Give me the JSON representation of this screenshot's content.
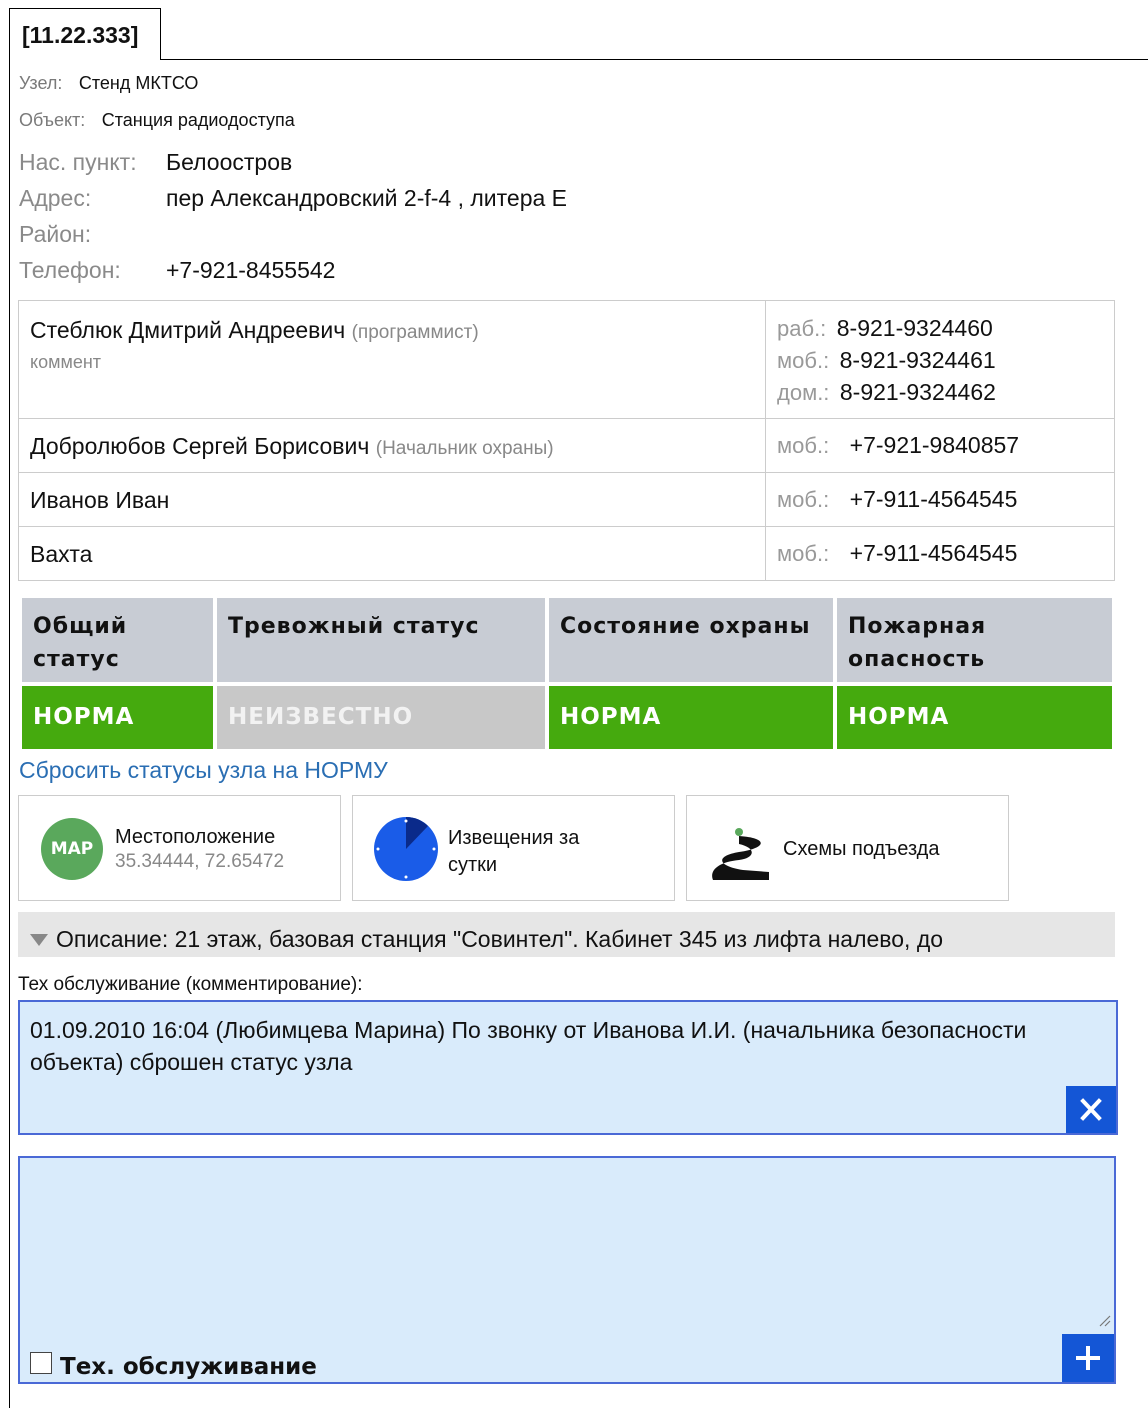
{
  "tab": {
    "label": "[11.22.333]"
  },
  "node": {
    "uzel_label": "Узел:",
    "uzel_value": "Стенд МКТСО",
    "object_label": "Объект:",
    "object_value": "Станция радиодоступа",
    "city_label": "Нас. пункт:",
    "city_value": "Белоостров",
    "address_label": "Адрес:",
    "address_value": "пер Александровский 2-f-4 , литера Е",
    "district_label": "Район:",
    "district_value": "",
    "phone_label": "Телефон:",
    "phone_value": "+7-921-8455542"
  },
  "contacts": [
    {
      "name": "Стеблюк Дмитрий Андреевич",
      "role": "(программист)",
      "comment": "коммент",
      "phones": [
        {
          "type": "раб.:",
          "number": "8-921-9324460"
        },
        {
          "type": "моб.:",
          "number": "8-921-9324461"
        },
        {
          "type": "дом.:",
          "number": "8-921-9324462"
        }
      ]
    },
    {
      "name": "Добролюбов Сергей Борисович",
      "role": "(Начальник охраны)",
      "phones": [
        {
          "type": "моб.:",
          "number": "+7-921-9840857"
        }
      ]
    },
    {
      "name": "Иванов Иван",
      "phones": [
        {
          "type": "моб.:",
          "number": "+7-911-4564545"
        }
      ]
    },
    {
      "name": "Вахта",
      "phones": [
        {
          "type": "моб.:",
          "number": "+7-911-4564545"
        }
      ]
    }
  ],
  "statuses": [
    {
      "header": "Общий статус",
      "value": "НОРМА",
      "color": "#45aa0e"
    },
    {
      "header": "Тревожный статус",
      "value": "НЕИЗВЕСТНО",
      "color": "#c8c8c8"
    },
    {
      "header": "Состояние охраны",
      "value": "НОРМА",
      "color": "#45aa0e"
    },
    {
      "header": "Пожарная опасность",
      "value": "НОРМА",
      "color": "#45aa0e"
    }
  ],
  "reset_link": "Сбросить статусы узла на НОРМУ",
  "tiles": {
    "location": {
      "icon": "map-icon",
      "icon_text": "MAP",
      "title": "Местоположение",
      "coords": "35.34444, 72.65472"
    },
    "notifications": {
      "icon": "clock-icon",
      "title": "Извещения за сутки"
    },
    "schemes": {
      "icon": "road-icon",
      "title": "Схемы подъезда"
    }
  },
  "description": "Описание: 21 этаж, базовая станция \"Совинтел\". Кабинет 345 из лифта налево, до",
  "maintenance": {
    "label": "Тех обслуживание (комментирование):",
    "comment": "01.09.2010 16:04 (Любимцева Марина) По звонку от Иванова И.И. (начальника безопасности объекта) сброшен статус узла",
    "new_comment_value": "",
    "checkbox_label": "Тех. обслуживание",
    "checkbox_checked": false
  },
  "colors": {
    "accent": "#1456d6",
    "norm": "#45aa0e",
    "unknown": "#c8c8c8",
    "header_bg": "#c8ccd4",
    "box_bg": "#d9ebfb",
    "link": "#2a6eb3"
  }
}
